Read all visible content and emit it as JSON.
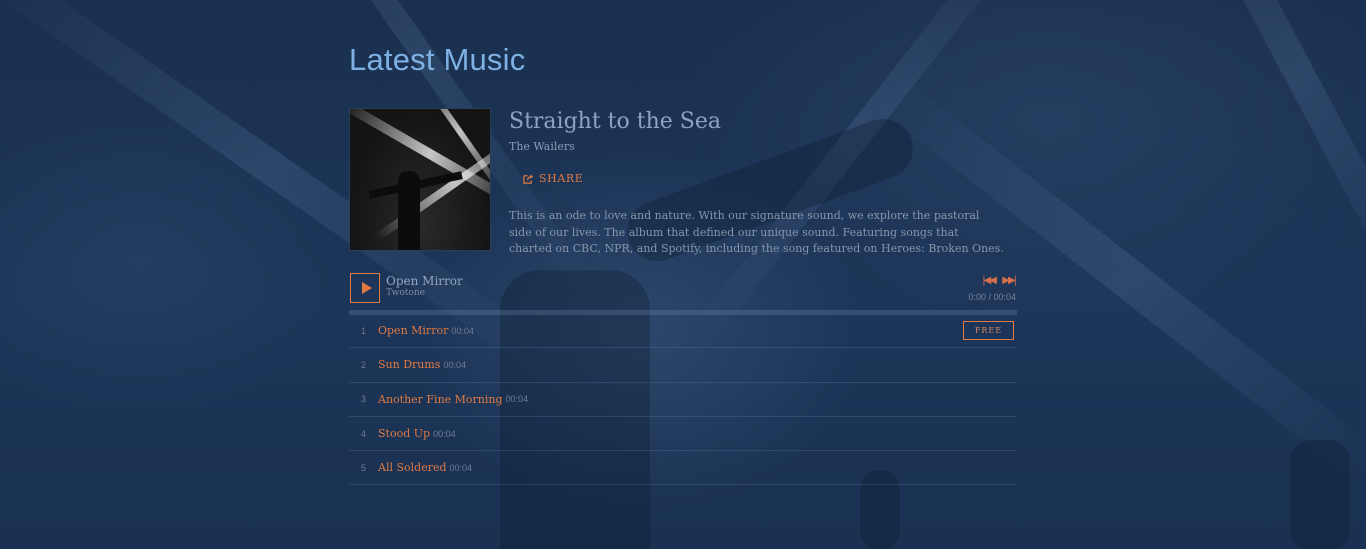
{
  "page": {
    "title": "Latest Music"
  },
  "album": {
    "title": "Straight to the Sea",
    "artist": "The Wailers",
    "share_label": "SHARE",
    "description": "This is an ode to love and nature. With our signature sound, we explore the pastoral side of our lives. The album that defined our unique sound. Featuring songs that charted on CBC, NPR, and Spotify, including the song featured on Heroes: Broken Ones."
  },
  "player": {
    "now_playing_title": "Open Mirror",
    "now_playing_artist": "Twotone",
    "time": "0:00 / 00:04",
    "progress": 0,
    "icons": {
      "play": "play-icon",
      "previous": "skip-previous-icon",
      "next": "skip-next-icon"
    }
  },
  "tracks": [
    {
      "number": "1",
      "title": "Open Mirror",
      "duration": "00:04",
      "badge": "FREE"
    },
    {
      "number": "2",
      "title": "Sun Drums",
      "duration": "00:04"
    },
    {
      "number": "3",
      "title": "Another Fine Morning",
      "duration": "00:04"
    },
    {
      "number": "4",
      "title": "Stood Up",
      "duration": "00:04"
    },
    {
      "number": "5",
      "title": "All Soldered",
      "duration": "00:04"
    }
  ],
  "colors": {
    "accent": "#e07a42",
    "heading": "#7fb0e3",
    "background": "#1b3354"
  }
}
